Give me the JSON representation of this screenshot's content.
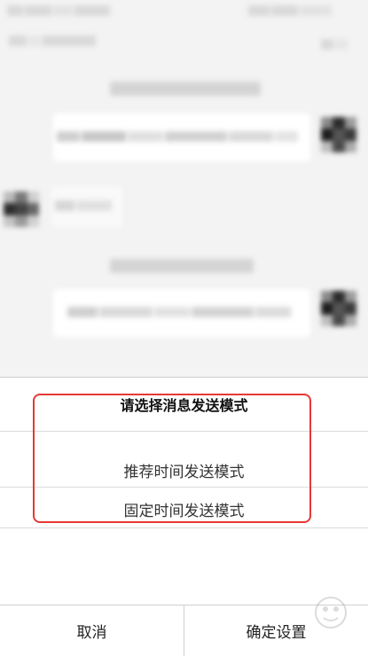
{
  "dialog": {
    "title": "请选择消息发送模式",
    "options": [
      {
        "label": "推荐时间发送模式"
      },
      {
        "label": "固定时间发送模式"
      }
    ]
  },
  "footer": {
    "cancel_label": "取消",
    "confirm_label": "确定设置"
  },
  "colors": {
    "highlight_frame": "#e53935",
    "background": "#f3f3f3",
    "divider": "#dcdcdc"
  },
  "icons": {
    "watermark": "watermark-logo-icon"
  }
}
